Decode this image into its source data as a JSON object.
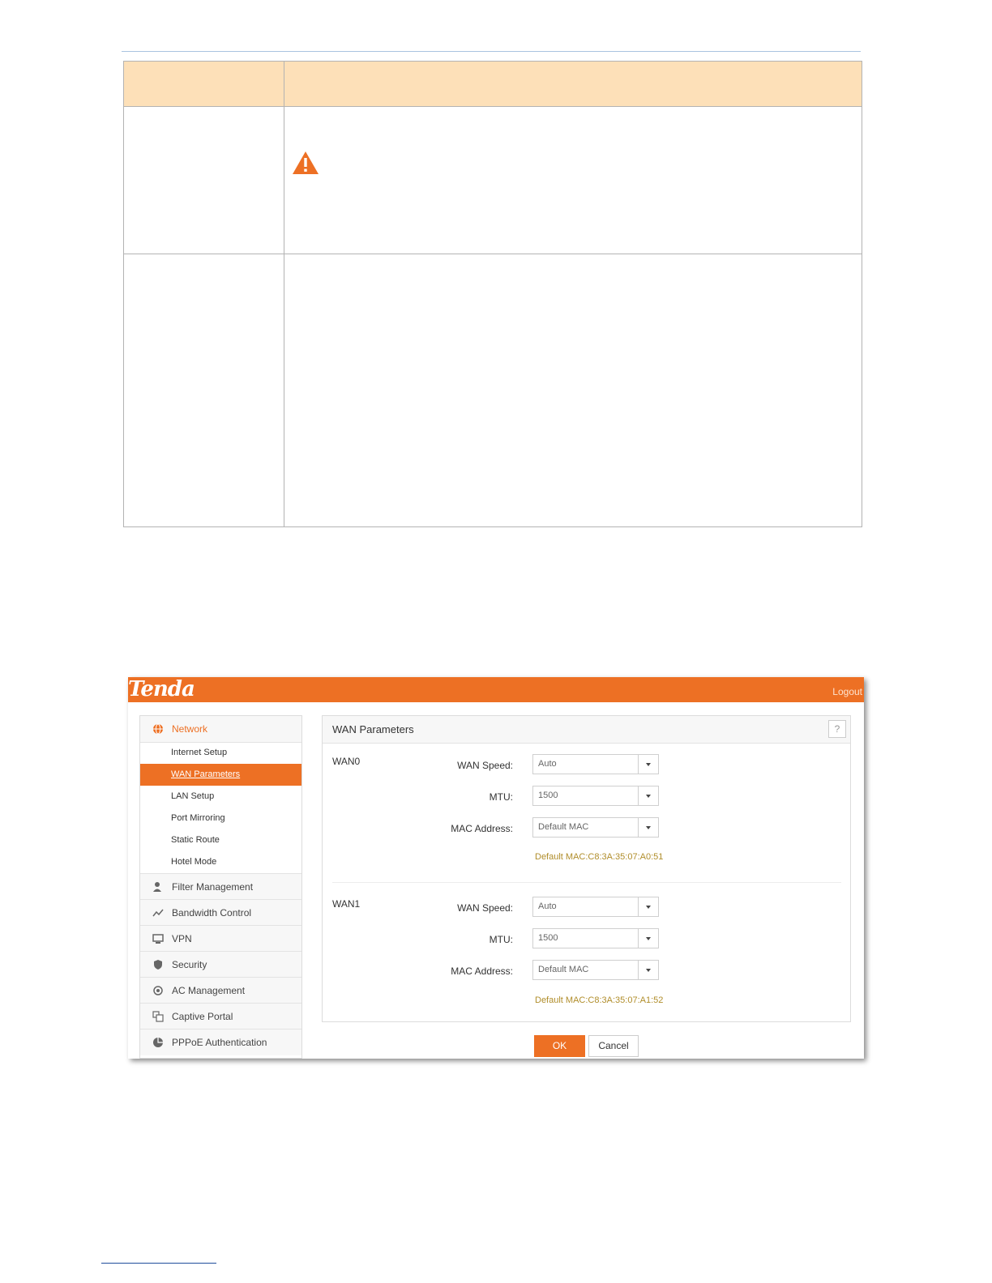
{
  "app": {
    "logo": "Tenda",
    "logout": "Logout"
  },
  "sidebar": {
    "section": "Network",
    "subitems": [
      "Internet Setup",
      "WAN Parameters",
      "LAN Setup",
      "Port Mirroring",
      "Static Route",
      "Hotel Mode"
    ],
    "active_subitem": "WAN Parameters",
    "items": [
      {
        "label": "Filter Management",
        "icon": "filter-icon"
      },
      {
        "label": "Bandwidth Control",
        "icon": "bandwidth-icon"
      },
      {
        "label": "VPN",
        "icon": "vpn-icon"
      },
      {
        "label": "Security",
        "icon": "security-icon"
      },
      {
        "label": "AC Management",
        "icon": "ac-management-icon"
      },
      {
        "label": "Captive Portal",
        "icon": "captive-portal-icon"
      },
      {
        "label": "PPPoE Authentication",
        "icon": "pppoe-icon"
      }
    ]
  },
  "panel": {
    "title": "WAN Parameters",
    "help": "?",
    "wan0": {
      "label": "WAN0",
      "speed_label": "WAN Speed:",
      "speed": "Auto",
      "mtu_label": "MTU:",
      "mtu": "1500",
      "mac_label": "MAC Address:",
      "mac": "Default MAC",
      "mac_note": "Default MAC:C8:3A:35:07:A0:51"
    },
    "wan1": {
      "label": "WAN1",
      "speed_label": "WAN Speed:",
      "speed": "Auto",
      "mtu_label": "MTU:",
      "mtu": "1500",
      "mac_label": "MAC Address:",
      "mac": "Default MAC",
      "mac_note": "Default MAC:C8:3A:35:07:A1:52"
    }
  },
  "buttons": {
    "ok": "OK",
    "cancel": "Cancel"
  },
  "colors": {
    "brand_orange": "#ed7024",
    "table_header": "#fde0b8",
    "mac_note": "#b08d2a"
  }
}
